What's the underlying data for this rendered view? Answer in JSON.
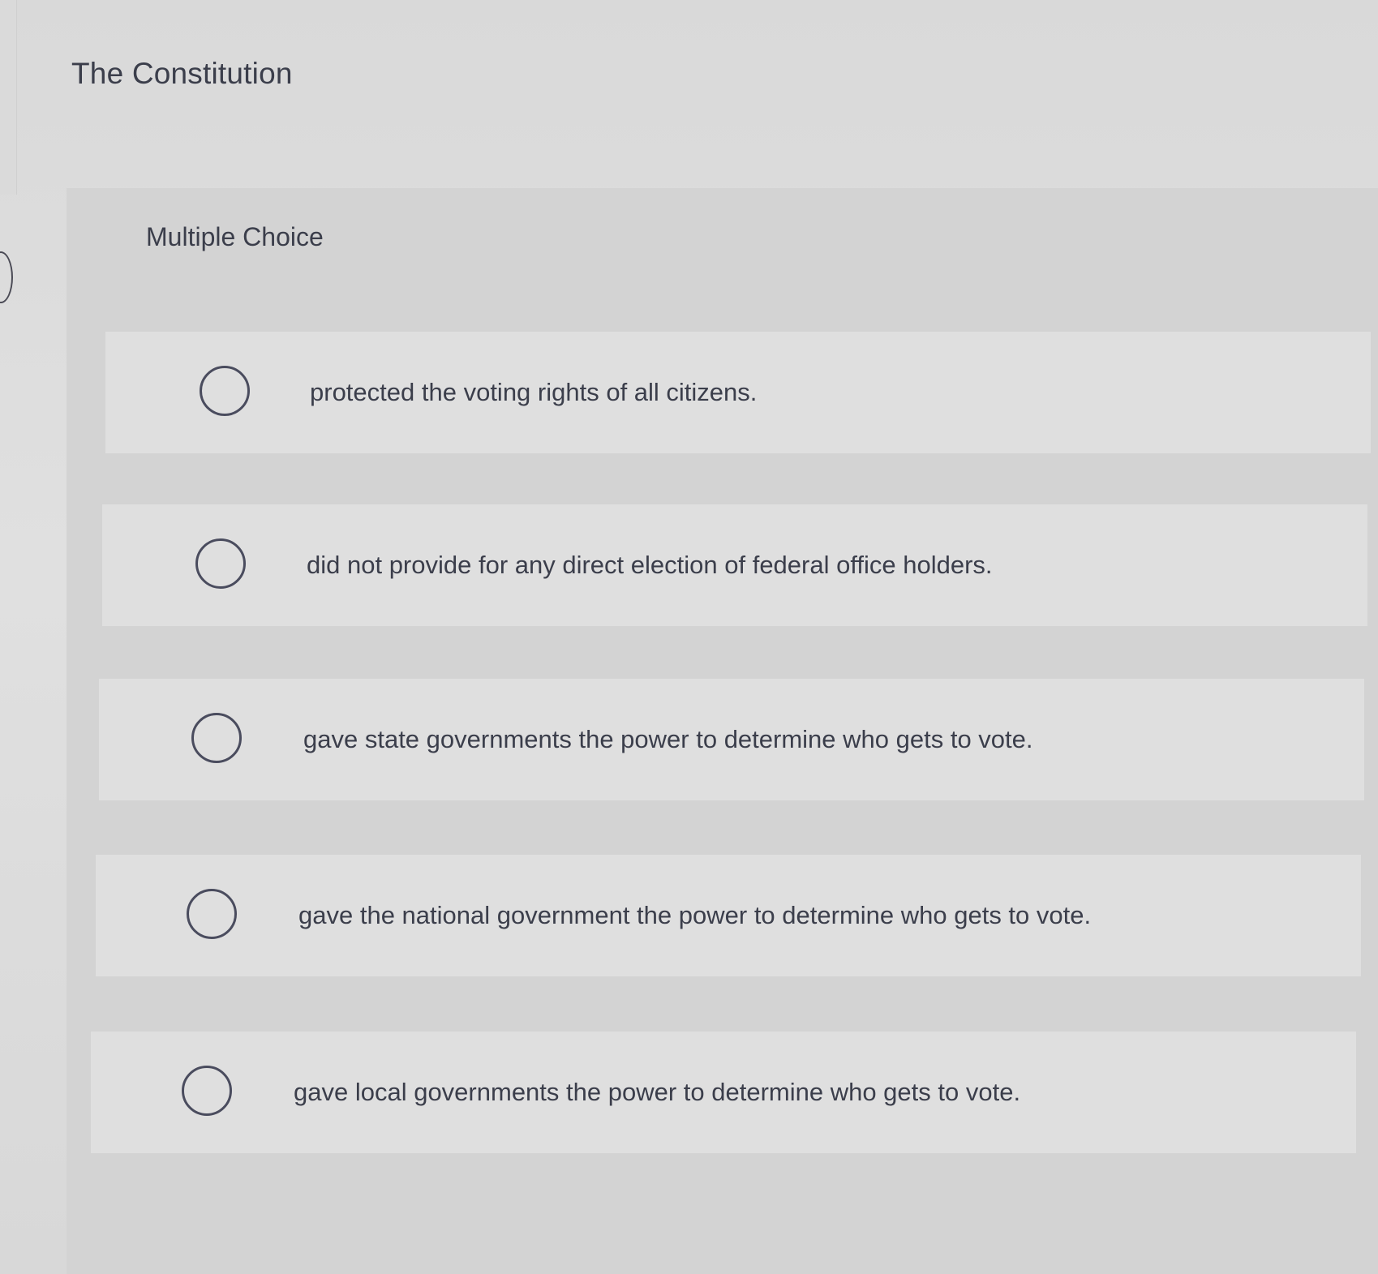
{
  "question": {
    "title": "The Constitution",
    "type_label": "Multiple Choice"
  },
  "options": [
    {
      "label": "protected the voting rights of all citizens.",
      "selected": false
    },
    {
      "label": "did not provide for any direct election of federal office holders.",
      "selected": false
    },
    {
      "label": "gave state governments the power to determine who gets to vote.",
      "selected": false
    },
    {
      "label": "gave the national government the power to determine who gets to vote.",
      "selected": false
    },
    {
      "label": "gave local governments the power to determine who gets to vote.",
      "selected": false
    }
  ],
  "colors": {
    "text": "#3b3e4b",
    "radio_border": "#4a4c5e",
    "option_background": "#dfdfdf",
    "panel_background": "#d3d3d3"
  }
}
